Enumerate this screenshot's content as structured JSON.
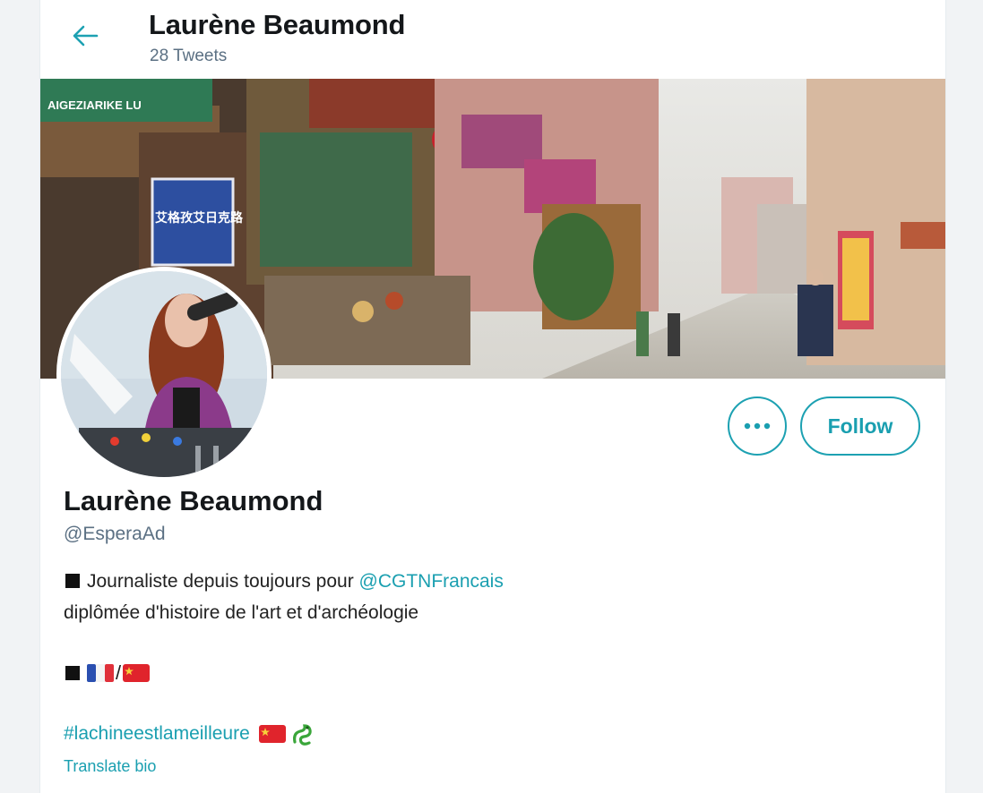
{
  "header": {
    "name": "Laurène Beaumond",
    "tweet_count": "28 Tweets"
  },
  "profile": {
    "display_name": "Laurène Beaumond",
    "handle": "@EsperaAd",
    "bio": {
      "line1_text": "Journaliste depuis toujours pour ",
      "line1_mention": "@CGTNFrancais",
      "line2_text": "diplômée d'histoire de l'art et d'archéologie",
      "flags_separator": "/",
      "hashtag": "#lachineestlameilleure"
    },
    "translate_label": "Translate bio"
  },
  "actions": {
    "more_label": "•••",
    "follow_label": "Follow"
  },
  "banner_signs": {
    "street_sign_latin": "AIGEZIARIKE LU",
    "street_sign_cjk": "艾格孜艾日克路"
  },
  "icons": {
    "back": "arrow-left-icon",
    "more": "more-dots-icon",
    "flag_france": "flag-france-icon",
    "flag_china": "flag-china-icon",
    "dragon": "dragon-emoji-icon"
  },
  "colors": {
    "accent": "#1da1b2",
    "text_secondary": "#5b7083"
  }
}
